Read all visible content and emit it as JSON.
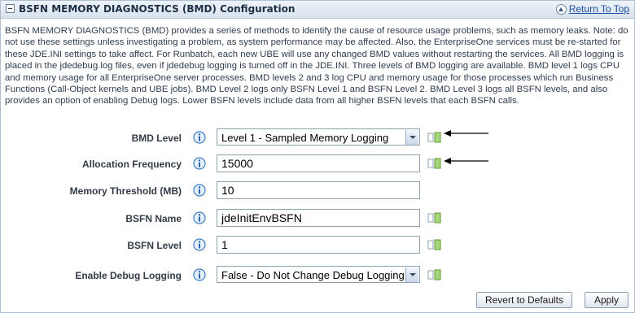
{
  "header": {
    "title": "BSFN MEMORY DIAGNOSTICS (BMD) Configuration",
    "return_link": "Return To Top",
    "collapse_icon": "collapse-minus-icon",
    "return_icon": "up-arrow-icon"
  },
  "description": "BSFN MEMORY DIAGNOSTICS (BMD) provides a series of methods to identify the cause of resource usage problems, such as memory leaks. Note: do not use these settings unless investigating a problem, as system performance may be affected. Also, the EnterpriseOne services must be re-started for these JDE.INI settings to take affect. For Runbatch, each new UBE will use any changed BMD values without restarting the services. All BMD logging is placed in the jdedebug.log files, even if jdedebug logging is turned off in the JDE.INI. Three levels of BMD logging are available. BMD level 1 logs CPU and memory usage for all EnterpriseOne server processes. BMD levels 2 and 3 log CPU and memory usage for those processes which run Business Functions (Call-Object kernels and UBE jobs). BMD Level 2 logs only BSFN Level 1 and BSFN Level 2. BMD Level 3 logs all BSFN levels, and also provides an option of enabling Debug logs. Lower BSFN levels include data from all higher BSFN levels that each BSFN calls.",
  "fields": {
    "bmd_level": {
      "label": "BMD Level",
      "value": "Level 1 - Sampled Memory Logging"
    },
    "allocation_frequency": {
      "label": "Allocation Frequency",
      "value": "15000"
    },
    "memory_threshold": {
      "label": "Memory Threshold (MB)",
      "value": "10"
    },
    "bsfn_name": {
      "label": "BSFN Name",
      "value": "jdeInitEnvBSFN"
    },
    "bsfn_level": {
      "label": "BSFN Level",
      "value": "1"
    },
    "enable_debug_logging": {
      "label": "Enable Debug Logging",
      "value": "False - Do Not Change Debug Logging"
    }
  },
  "buttons": {
    "revert": "Revert to Defaults",
    "apply": "Apply"
  },
  "colors": {
    "header_bg": "#d9e3ee",
    "link": "#1f4fa0",
    "info_icon": "#3f7cc8",
    "override_icon": "#7bb84a"
  }
}
